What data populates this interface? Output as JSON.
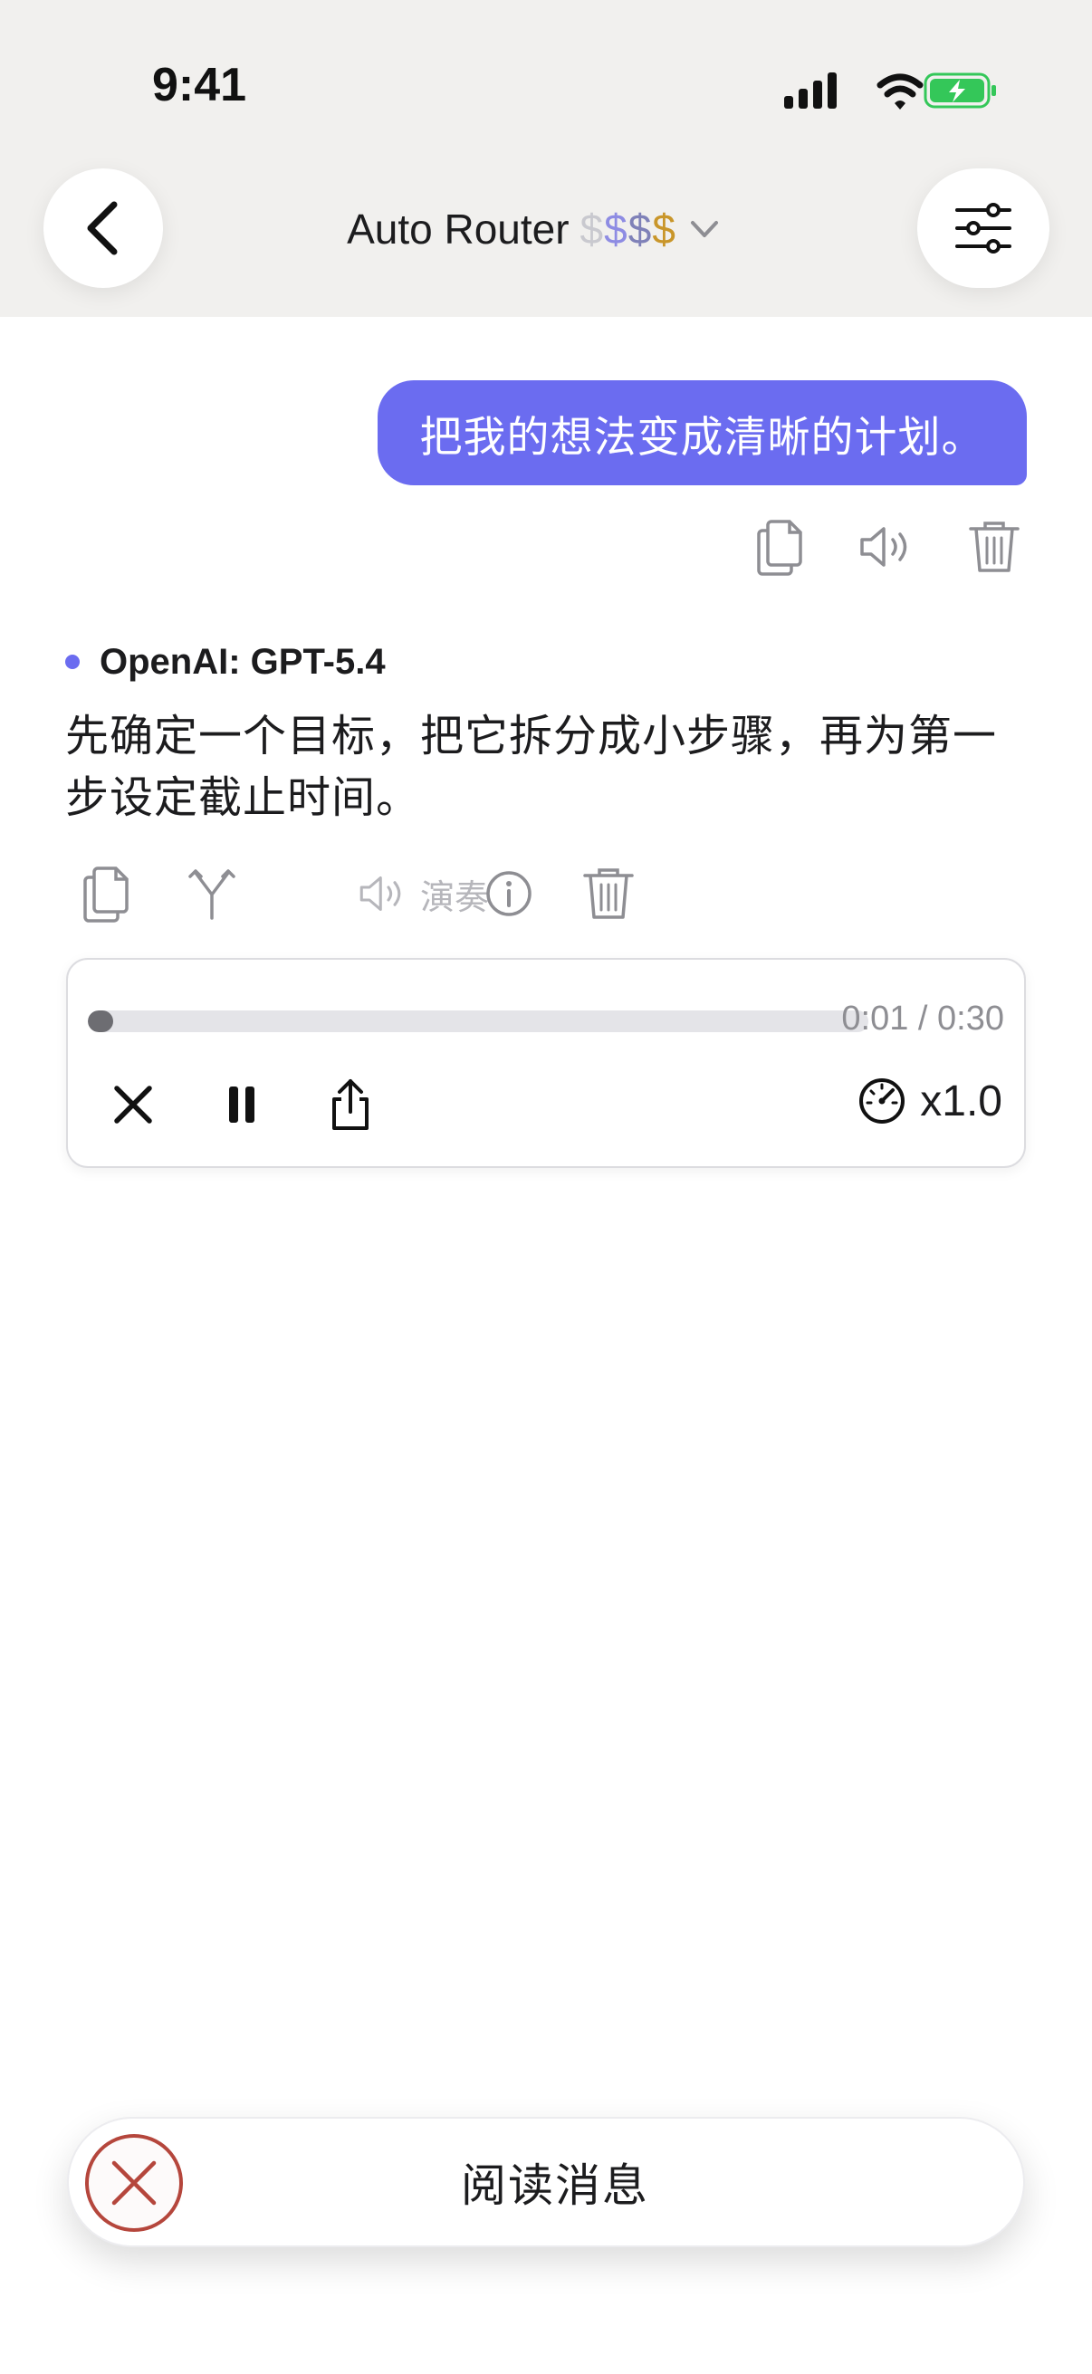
{
  "status_bar": {
    "time": "9:41",
    "icons": [
      "signal-icon",
      "wifi-icon",
      "battery-charging-icon"
    ],
    "battery_color": "#34c759"
  },
  "header": {
    "back_icon": "chevron-left-icon",
    "model_name": "Auto Router",
    "price_tier": [
      "$",
      "$",
      "$",
      "$"
    ],
    "dropdown_icon": "chevron-down-icon",
    "settings_icon": "sliders-icon"
  },
  "user_message": {
    "text": "把我的想法变成清晰的计划。",
    "bubble_color": "#6b6cf0",
    "actions": [
      "copy-icon",
      "speaker-icon",
      "trash-icon"
    ]
  },
  "assistant_message": {
    "model": "OpenAI: GPT-5.4",
    "text": "先确定一个目标，把它拆分成小步骤，再为第一步设定截止时间。",
    "actions": {
      "icons": [
        "copy-icon",
        "branch-icon",
        "speaker-icon",
        "info-icon",
        "trash-icon"
      ],
      "play_label": "演奏"
    }
  },
  "audio_player": {
    "current_time": "0:01",
    "duration": "0:30",
    "time_display": "0:01 / 0:30",
    "progress": 0.033,
    "speed": "x1.0",
    "controls": [
      "close-icon",
      "pause-icon",
      "share-icon",
      "speedometer-icon"
    ]
  },
  "bottom_bar": {
    "label": "阅读消息",
    "stop_icon": "stop-circle-x-icon",
    "stop_color": "#b5463c"
  }
}
